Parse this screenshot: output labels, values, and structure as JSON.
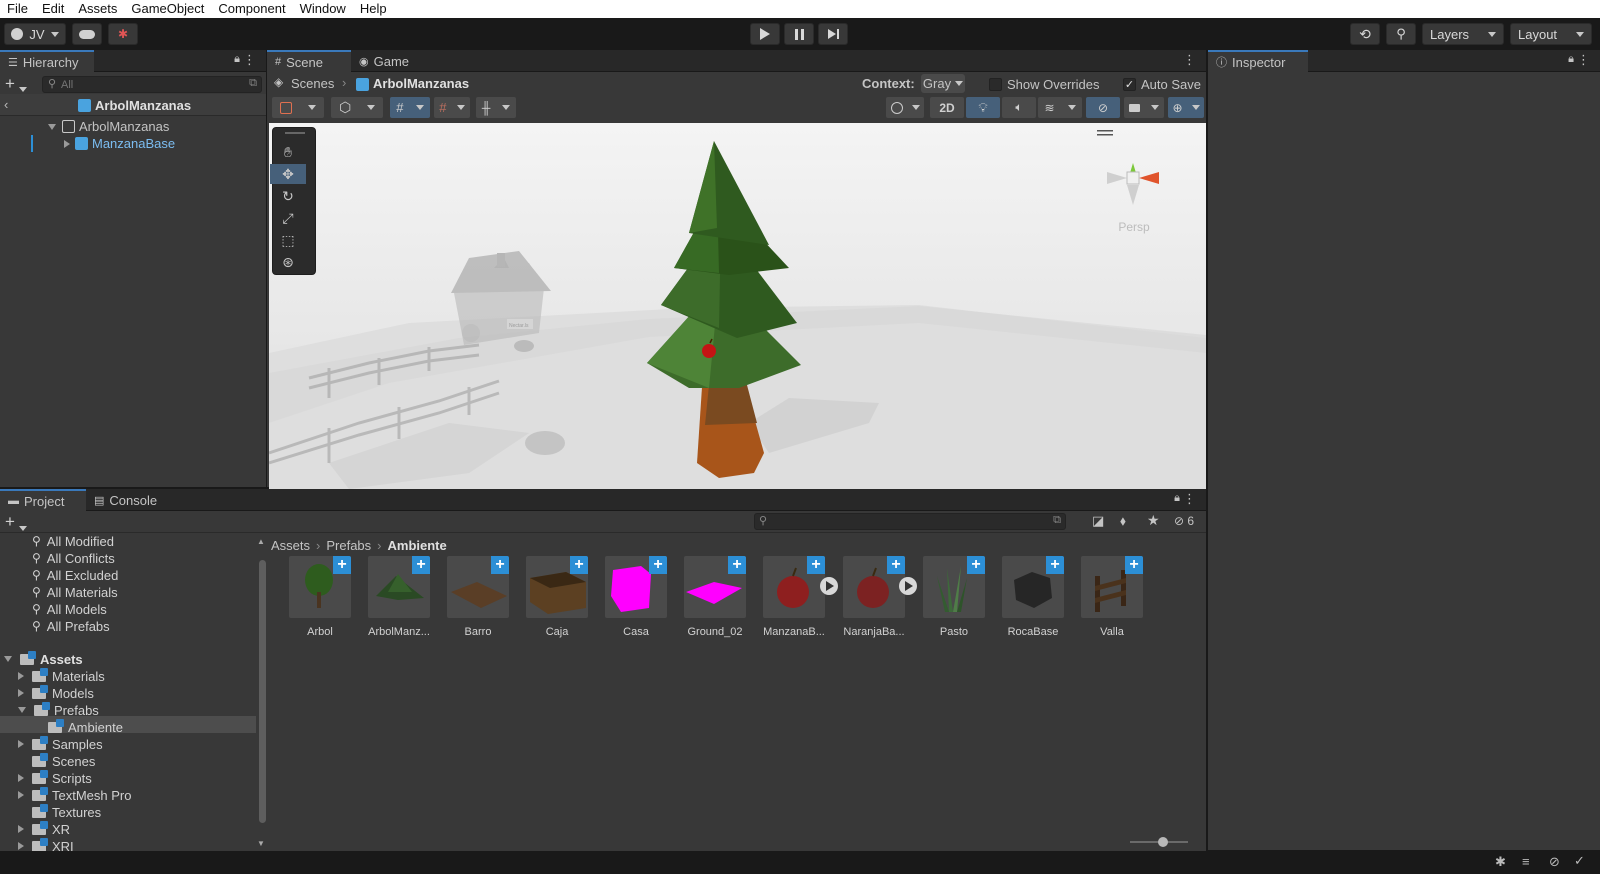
{
  "menu": [
    "File",
    "Edit",
    "Assets",
    "GameObject",
    "Component",
    "Window",
    "Help"
  ],
  "toolbar": {
    "account": "JV",
    "layers": "Layers",
    "layout": "Layout"
  },
  "hierarchy": {
    "tab": "Hierarchy",
    "search_placeholder": "All",
    "scene_header": "ArbolManzanas",
    "items": [
      {
        "label": "ArbolManzanas",
        "depth": 1
      },
      {
        "label": "ManzanaBase",
        "depth": 2
      }
    ]
  },
  "scene": {
    "tabs": [
      "Scene",
      "Game"
    ],
    "breadcrumb": [
      "Scenes",
      "ArbolManzanas"
    ],
    "context_label": "Context:",
    "context_value": "Gray",
    "show_overrides": "Show Overrides",
    "auto_save": "Auto Save",
    "auto_save_checked": true,
    "btn_2d": "2D",
    "persp_label": "Persp",
    "sign_text": "Nectar.ls"
  },
  "inspector": {
    "tab": "Inspector"
  },
  "project": {
    "tabs": [
      "Project",
      "Console"
    ],
    "hidden_count": "6",
    "favorites": [
      "All Modified",
      "All Conflicts",
      "All Excluded",
      "All Materials",
      "All Models",
      "All Prefabs"
    ],
    "assets_root": "Assets",
    "folders": [
      {
        "label": "Materials",
        "expanded": false
      },
      {
        "label": "Models",
        "expanded": false
      },
      {
        "label": "Prefabs",
        "expanded": true
      },
      {
        "label": "Ambiente",
        "child": true,
        "selected": true
      },
      {
        "label": "Samples",
        "expanded": false
      },
      {
        "label": "Scenes",
        "expanded": false
      },
      {
        "label": "Scripts",
        "expanded": false
      },
      {
        "label": "TextMesh Pro",
        "expanded": false
      },
      {
        "label": "Textures",
        "expanded": false
      },
      {
        "label": "XR",
        "expanded": false
      },
      {
        "label": "XRI",
        "expanded": false
      }
    ],
    "breadcrumb": [
      "Assets",
      "Prefabs",
      "Ambiente"
    ],
    "assets": [
      "Arbol",
      "ArbolManz...",
      "Barro",
      "Caja",
      "Casa",
      "Ground_02",
      "ManzanaB...",
      "NaranjaBa...",
      "Pasto",
      "RocaBase",
      "Valla"
    ]
  },
  "colors": {
    "accent": "#3a79bb",
    "prefab_blue": "#4aa3df",
    "panel_bg": "#383838",
    "dark_bg": "#191919"
  }
}
